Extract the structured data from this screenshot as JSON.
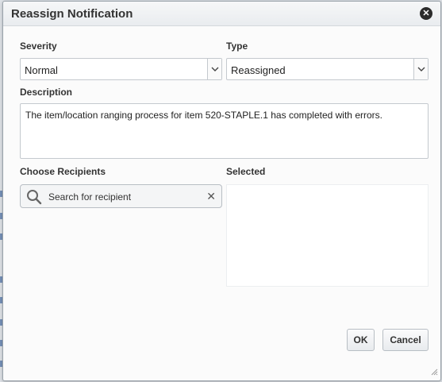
{
  "dialog": {
    "title": "Reassign Notification",
    "close_icon": "close-circle-icon"
  },
  "severity": {
    "label": "Severity",
    "value": "Normal"
  },
  "type": {
    "label": "Type",
    "value": "Reassigned"
  },
  "description": {
    "label": "Description",
    "value": "The item/location ranging process for item 520-STAPLE.1 has completed with errors."
  },
  "recipients": {
    "label": "Choose Recipients",
    "search_placeholder": "Search for recipient",
    "search_icon": "search-icon",
    "clear_icon": "clear-icon"
  },
  "selected": {
    "label": "Selected"
  },
  "buttons": {
    "ok": "OK",
    "cancel": "Cancel"
  },
  "colors": {
    "accent_bg": "#fbfbfb",
    "border": "#c4c9ce",
    "close_bg": "#2b2b2b"
  }
}
